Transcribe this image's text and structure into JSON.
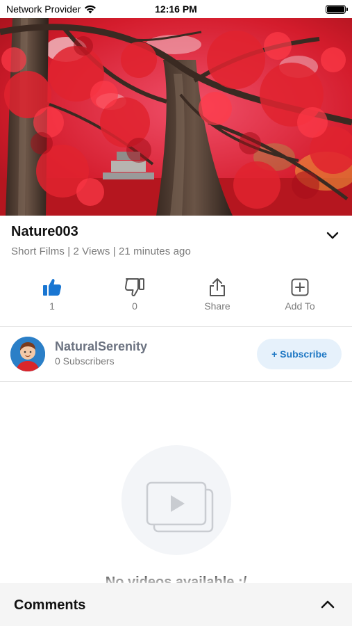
{
  "status_bar": {
    "carrier": "Network Provider",
    "time": "12:16 PM",
    "wifi_icon": "wifi-icon",
    "battery_icon": "battery-icon"
  },
  "video": {
    "title": "Nature003",
    "meta": "Short Films | 2 Views | 21 minutes ago",
    "thumbnail": "red-maple-forest-image"
  },
  "actions": {
    "like_count": "1",
    "dislike_count": "0",
    "share_label": "Share",
    "add_to_label": "Add To"
  },
  "channel": {
    "name": "NaturalSerenity",
    "subscribers": "0 Subscribers",
    "subscribe_label": "+ Subscribe"
  },
  "empty_state": {
    "text": "No videos available :/"
  },
  "comments": {
    "title": "Comments"
  },
  "colors": {
    "accent": "#1f78c4",
    "like_active": "#1976d2",
    "subscribe_bg": "#e6f1fb",
    "muted_text": "#7a7a7a"
  }
}
